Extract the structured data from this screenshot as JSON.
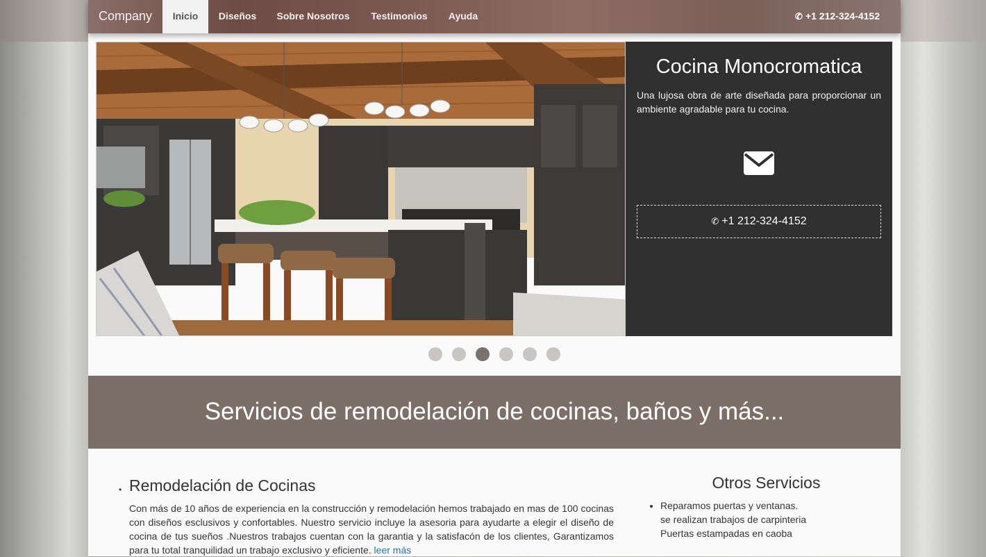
{
  "nav": {
    "brand": "Company",
    "items": [
      "Inicio",
      "Diseños",
      "Sobre Nosotros",
      "Testimonios",
      "Ayuda"
    ],
    "active_index": 0,
    "phone": "+1 212-324-4152",
    "phone_icon": "phone-icon"
  },
  "carousel": {
    "title": "Cocina Monocromatica",
    "description": "Una lujosa obra de arte diseñada para proporcionar un ambiente agradable para tu cocina.",
    "mail_icon": "envelope-icon",
    "phone": "+1 212-324-4152",
    "slide_count": 6,
    "active_slide": 3
  },
  "banner": {
    "title": "Servicios de remodelación de cocinas, baños y más..."
  },
  "service": {
    "title": "Remodelación de Cocinas",
    "text": "Con más de 10 años de experiencia en la construcción y remodelación hemos trabajado en mas de 100 cocinas con diseños esclusivos y confortables. Nuestro servicio incluye la asesoria para ayudarte a elegir el diseño de cocina de tus sueños .Nuestros trabajos cuentan con la garantia y la satisfacón de los clientes, Garantizamos para tu total tranquilidad un trabajo exclusivo y eficiente.",
    "read_more": "leer más"
  },
  "sidebar": {
    "title": "Otros Servicios",
    "lines": [
      "Reparamos puertas y ventanas.",
      "se realizan trabajos de carpinteria",
      "Puertas estampadas en caoba"
    ]
  },
  "colors": {
    "banner": "#7b6f68",
    "panel": "#303030",
    "link": "#2a6fb8",
    "dot_active": "#7b716b",
    "dot": "#c8c5c3"
  }
}
